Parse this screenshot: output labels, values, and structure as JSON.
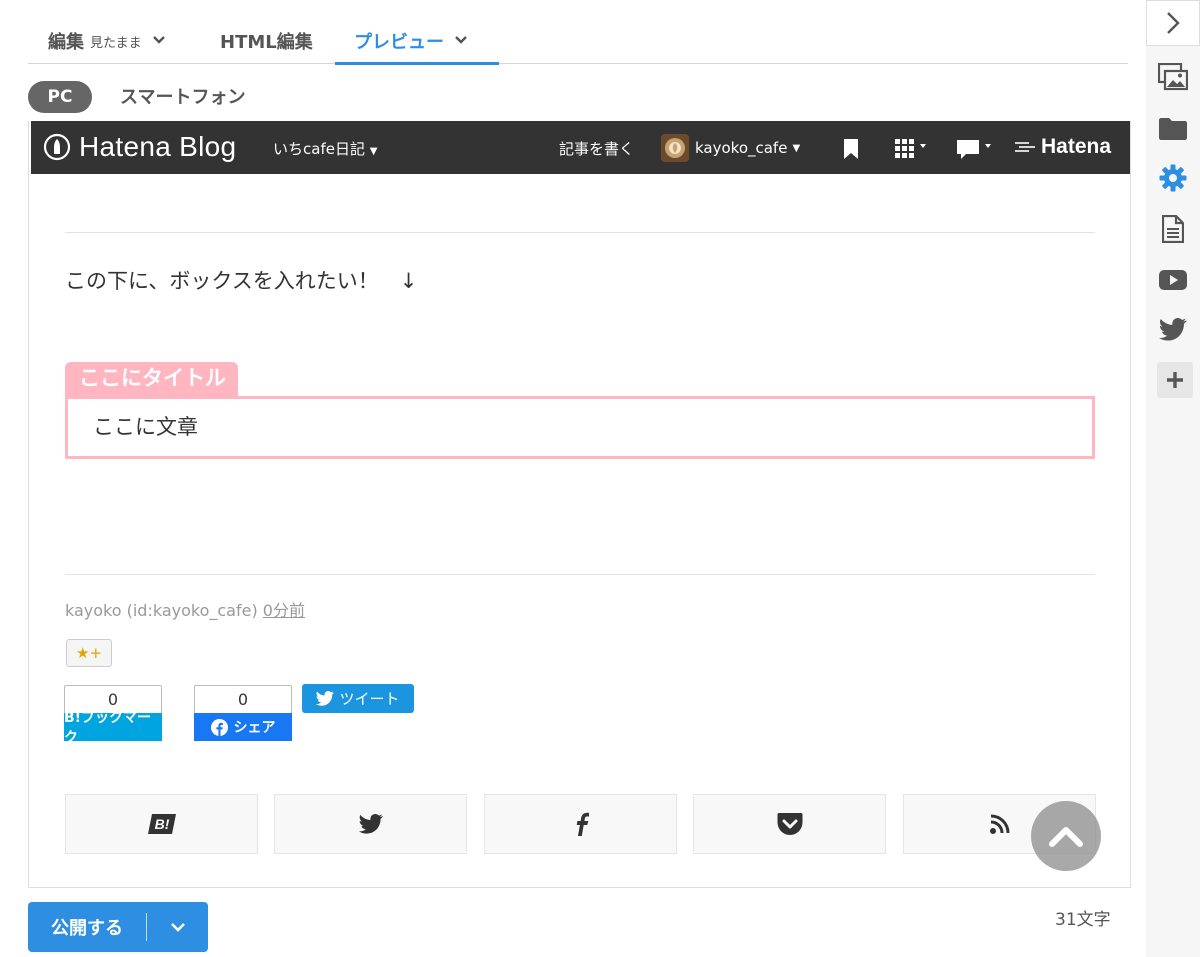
{
  "editor_tabs": {
    "edit_label": "編集",
    "edit_mode": "見たまま",
    "html_label": "HTML編集",
    "preview_label": "プレビュー"
  },
  "device": {
    "pc_label": "PC",
    "smartphone_label": "スマートフォン"
  },
  "hatena_bar": {
    "logo_text": "Hatena Blog",
    "blog_name": "いちcafe日記",
    "write_label": "記事を書く",
    "username": "kayoko_cafe",
    "brand": "Hatena"
  },
  "article": {
    "text": "この下に、ボックスを入れたい！　↓",
    "box_title": "ここにタイトル",
    "box_body": "ここに文章",
    "byline_author": "kayoko (id:kayoko_cafe)",
    "byline_time": "0分前"
  },
  "share": {
    "star_label": "+",
    "bookmark_count": "0",
    "bookmark_label": "B!ブックマーク",
    "facebook_count": "0",
    "facebook_label": "シェア",
    "tweet_label": "ツイート"
  },
  "social_tiles": [
    "hatena-bookmark-icon",
    "twitter-icon",
    "facebook-icon",
    "pocket-icon",
    "rss-icon"
  ],
  "footer": {
    "publish_label": "公開する",
    "char_count": "31文字"
  },
  "colors": {
    "accent": "#2d8ee2",
    "box_pink": "#ffb6c1",
    "bar_dark": "#333333",
    "bookmark_blue": "#00a4de",
    "facebook_blue": "#1877f2",
    "twitter_blue": "#1b95e0"
  }
}
